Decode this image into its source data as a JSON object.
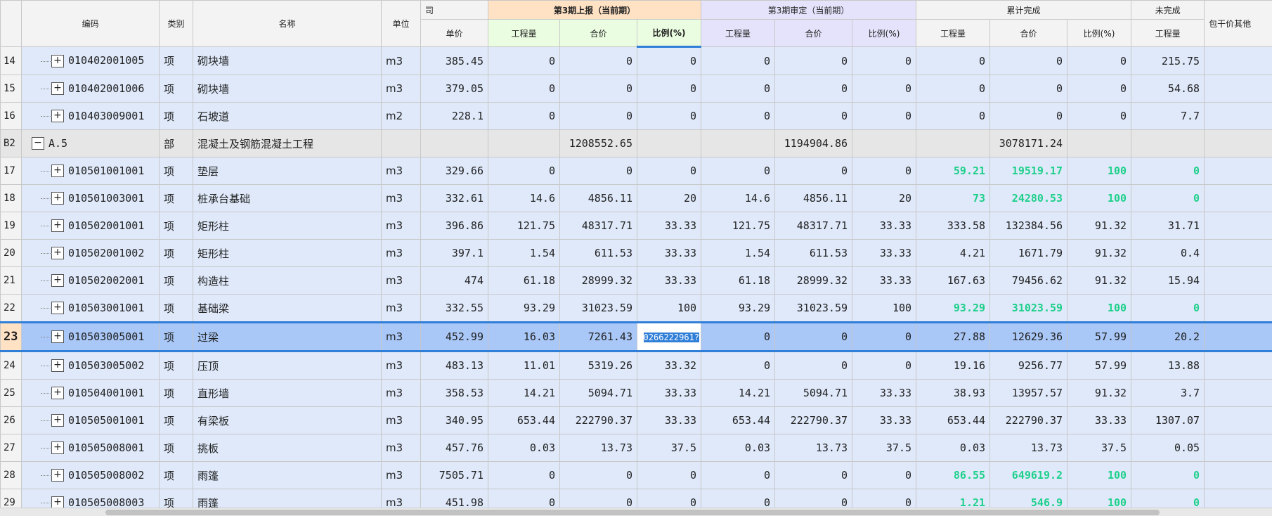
{
  "headers": {
    "code": "编码",
    "type": "类别",
    "name": "名称",
    "unit": "单位",
    "price_group_partial": "司",
    "g1": "第3期上报（当前期）",
    "g2": "第3期审定（当前期）",
    "g3": "累计完成",
    "g4": "未完成",
    "g5_partial": "包干价其他",
    "unit_price": "单价",
    "qty": "工程量",
    "total": "合价",
    "ratio_hl": "比例(%)",
    "ratio": "比例(%)"
  },
  "rows": [
    {
      "rn": "14",
      "code": "010402001005",
      "type": "项",
      "name": "砌块墙",
      "unit": "m3",
      "price": "385.45",
      "q1": "0",
      "t1": "0",
      "r1": "0",
      "q2": "0",
      "t2": "0",
      "r2": "0",
      "q3": "0",
      "t3": "0",
      "r3": "0",
      "q4": "215.75"
    },
    {
      "rn": "15",
      "code": "010402001006",
      "type": "项",
      "name": "砌块墙",
      "unit": "m3",
      "price": "379.05",
      "q1": "0",
      "t1": "0",
      "r1": "0",
      "q2": "0",
      "t2": "0",
      "r2": "0",
      "q3": "0",
      "t3": "0",
      "r3": "0",
      "q4": "54.68"
    },
    {
      "rn": "16",
      "code": "010403009001",
      "type": "项",
      "name": "石坡道",
      "unit": "m2",
      "price": "228.1",
      "q1": "0",
      "t1": "0",
      "r1": "0",
      "q2": "0",
      "t2": "0",
      "r2": "0",
      "q3": "0",
      "t3": "0",
      "r3": "0",
      "q4": "7.7"
    },
    {
      "rn": "B2",
      "code": "A.5",
      "type": "部",
      "name": "混凝土及钢筋混凝土工程",
      "unit": "",
      "price": "",
      "q1": "",
      "t1": "1208552.65",
      "r1": "",
      "q2": "",
      "t2": "1194904.86",
      "r2": "",
      "q3": "",
      "t3": "3078171.24",
      "r3": "",
      "q4": ""
    },
    {
      "rn": "17",
      "code": "010501001001",
      "type": "项",
      "name": "垫层",
      "unit": "m3",
      "price": "329.66",
      "q1": "0",
      "t1": "0",
      "r1": "0",
      "q2": "0",
      "t2": "0",
      "r2": "0",
      "q3": "59.21",
      "t3": "19519.17",
      "r3": "100",
      "q4": "0"
    },
    {
      "rn": "18",
      "code": "010501003001",
      "type": "项",
      "name": "桩承台基础",
      "unit": "m3",
      "price": "332.61",
      "q1": "14.6",
      "t1": "4856.11",
      "r1": "20",
      "q2": "14.6",
      "t2": "4856.11",
      "r2": "20",
      "q3": "73",
      "t3": "24280.53",
      "r3": "100",
      "q4": "0"
    },
    {
      "rn": "19",
      "code": "010502001001",
      "type": "项",
      "name": "矩形柱",
      "unit": "m3",
      "price": "396.86",
      "q1": "121.75",
      "t1": "48317.71",
      "r1": "33.33",
      "q2": "121.75",
      "t2": "48317.71",
      "r2": "33.33",
      "q3": "333.58",
      "t3": "132384.56",
      "r3": "91.32",
      "q4": "31.71"
    },
    {
      "rn": "20",
      "code": "010502001002",
      "type": "项",
      "name": "矩形柱",
      "unit": "m3",
      "price": "397.1",
      "q1": "1.54",
      "t1": "611.53",
      "r1": "33.33",
      "q2": "1.54",
      "t2": "611.53",
      "r2": "33.33",
      "q3": "4.21",
      "t3": "1671.79",
      "r3": "91.32",
      "q4": "0.4"
    },
    {
      "rn": "21",
      "code": "010502002001",
      "type": "项",
      "name": "构造柱",
      "unit": "m3",
      "price": "474",
      "q1": "61.18",
      "t1": "28999.32",
      "r1": "33.33",
      "q2": "61.18",
      "t2": "28999.32",
      "r2": "33.33",
      "q3": "167.63",
      "t3": "79456.62",
      "r3": "91.32",
      "q4": "15.94"
    },
    {
      "rn": "22",
      "code": "010503001001",
      "type": "项",
      "name": "基础梁",
      "unit": "m3",
      "price": "332.55",
      "q1": "93.29",
      "t1": "31023.59",
      "r1": "100",
      "q2": "93.29",
      "t2": "31023.59",
      "r2": "100",
      "q3": "93.29",
      "t3": "31023.59",
      "r3": "100",
      "q4": "0"
    },
    {
      "rn": "23",
      "code": "010503005001",
      "type": "项",
      "name": "过梁",
      "unit": "m3",
      "price": "452.99",
      "q1": "16.03",
      "t1": "7261.43",
      "r1": "0266222961?",
      "q2": "0",
      "t2": "0",
      "r2": "0",
      "q3": "27.88",
      "t3": "12629.36",
      "r3": "57.99",
      "q4": "20.2"
    },
    {
      "rn": "24",
      "code": "010503005002",
      "type": "项",
      "name": "压顶",
      "unit": "m3",
      "price": "483.13",
      "q1": "11.01",
      "t1": "5319.26",
      "r1": "33.32",
      "q2": "0",
      "t2": "0",
      "r2": "0",
      "q3": "19.16",
      "t3": "9256.77",
      "r3": "57.99",
      "q4": "13.88"
    },
    {
      "rn": "25",
      "code": "010504001001",
      "type": "项",
      "name": "直形墙",
      "unit": "m3",
      "price": "358.53",
      "q1": "14.21",
      "t1": "5094.71",
      "r1": "33.33",
      "q2": "14.21",
      "t2": "5094.71",
      "r2": "33.33",
      "q3": "38.93",
      "t3": "13957.57",
      "r3": "91.32",
      "q4": "3.7"
    },
    {
      "rn": "26",
      "code": "010505001001",
      "type": "项",
      "name": "有梁板",
      "unit": "m3",
      "price": "340.95",
      "q1": "653.44",
      "t1": "222790.37",
      "r1": "33.33",
      "q2": "653.44",
      "t2": "222790.37",
      "r2": "33.33",
      "q3": "653.44",
      "t3": "222790.37",
      "r3": "33.33",
      "q4": "1307.07"
    },
    {
      "rn": "27",
      "code": "010505008001",
      "type": "项",
      "name": "挑板",
      "unit": "m3",
      "price": "457.76",
      "q1": "0.03",
      "t1": "13.73",
      "r1": "37.5",
      "q2": "0.03",
      "t2": "13.73",
      "r2": "37.5",
      "q3": "0.03",
      "t3": "13.73",
      "r3": "37.5",
      "q4": "0.05"
    },
    {
      "rn": "28",
      "code": "010505008002",
      "type": "项",
      "name": "雨篷",
      "unit": "m3",
      "price": "7505.71",
      "q1": "0",
      "t1": "0",
      "r1": "0",
      "q2": "0",
      "t2": "0",
      "r2": "0",
      "q3": "86.55",
      "t3": "649619.2",
      "r3": "100",
      "q4": "0"
    },
    {
      "rn": "29",
      "code": "010505008003",
      "type": "项",
      "name": "雨篷",
      "unit": "m3",
      "price": "451.98",
      "q1": "0",
      "t1": "0",
      "r1": "0",
      "q2": "0",
      "t2": "0",
      "r2": "0",
      "q3": "1.21",
      "t3": "546.9",
      "r3": "100",
      "q4": "0"
    }
  ],
  "green_rows": [
    "17",
    "18",
    "22",
    "28",
    "29"
  ],
  "selected_row": "23",
  "colors": {
    "complete_green": "#1fd08b",
    "selection": "#2f7ed8",
    "group_current": "#ffe1c4",
    "group_audit": "#e5e3fb"
  }
}
